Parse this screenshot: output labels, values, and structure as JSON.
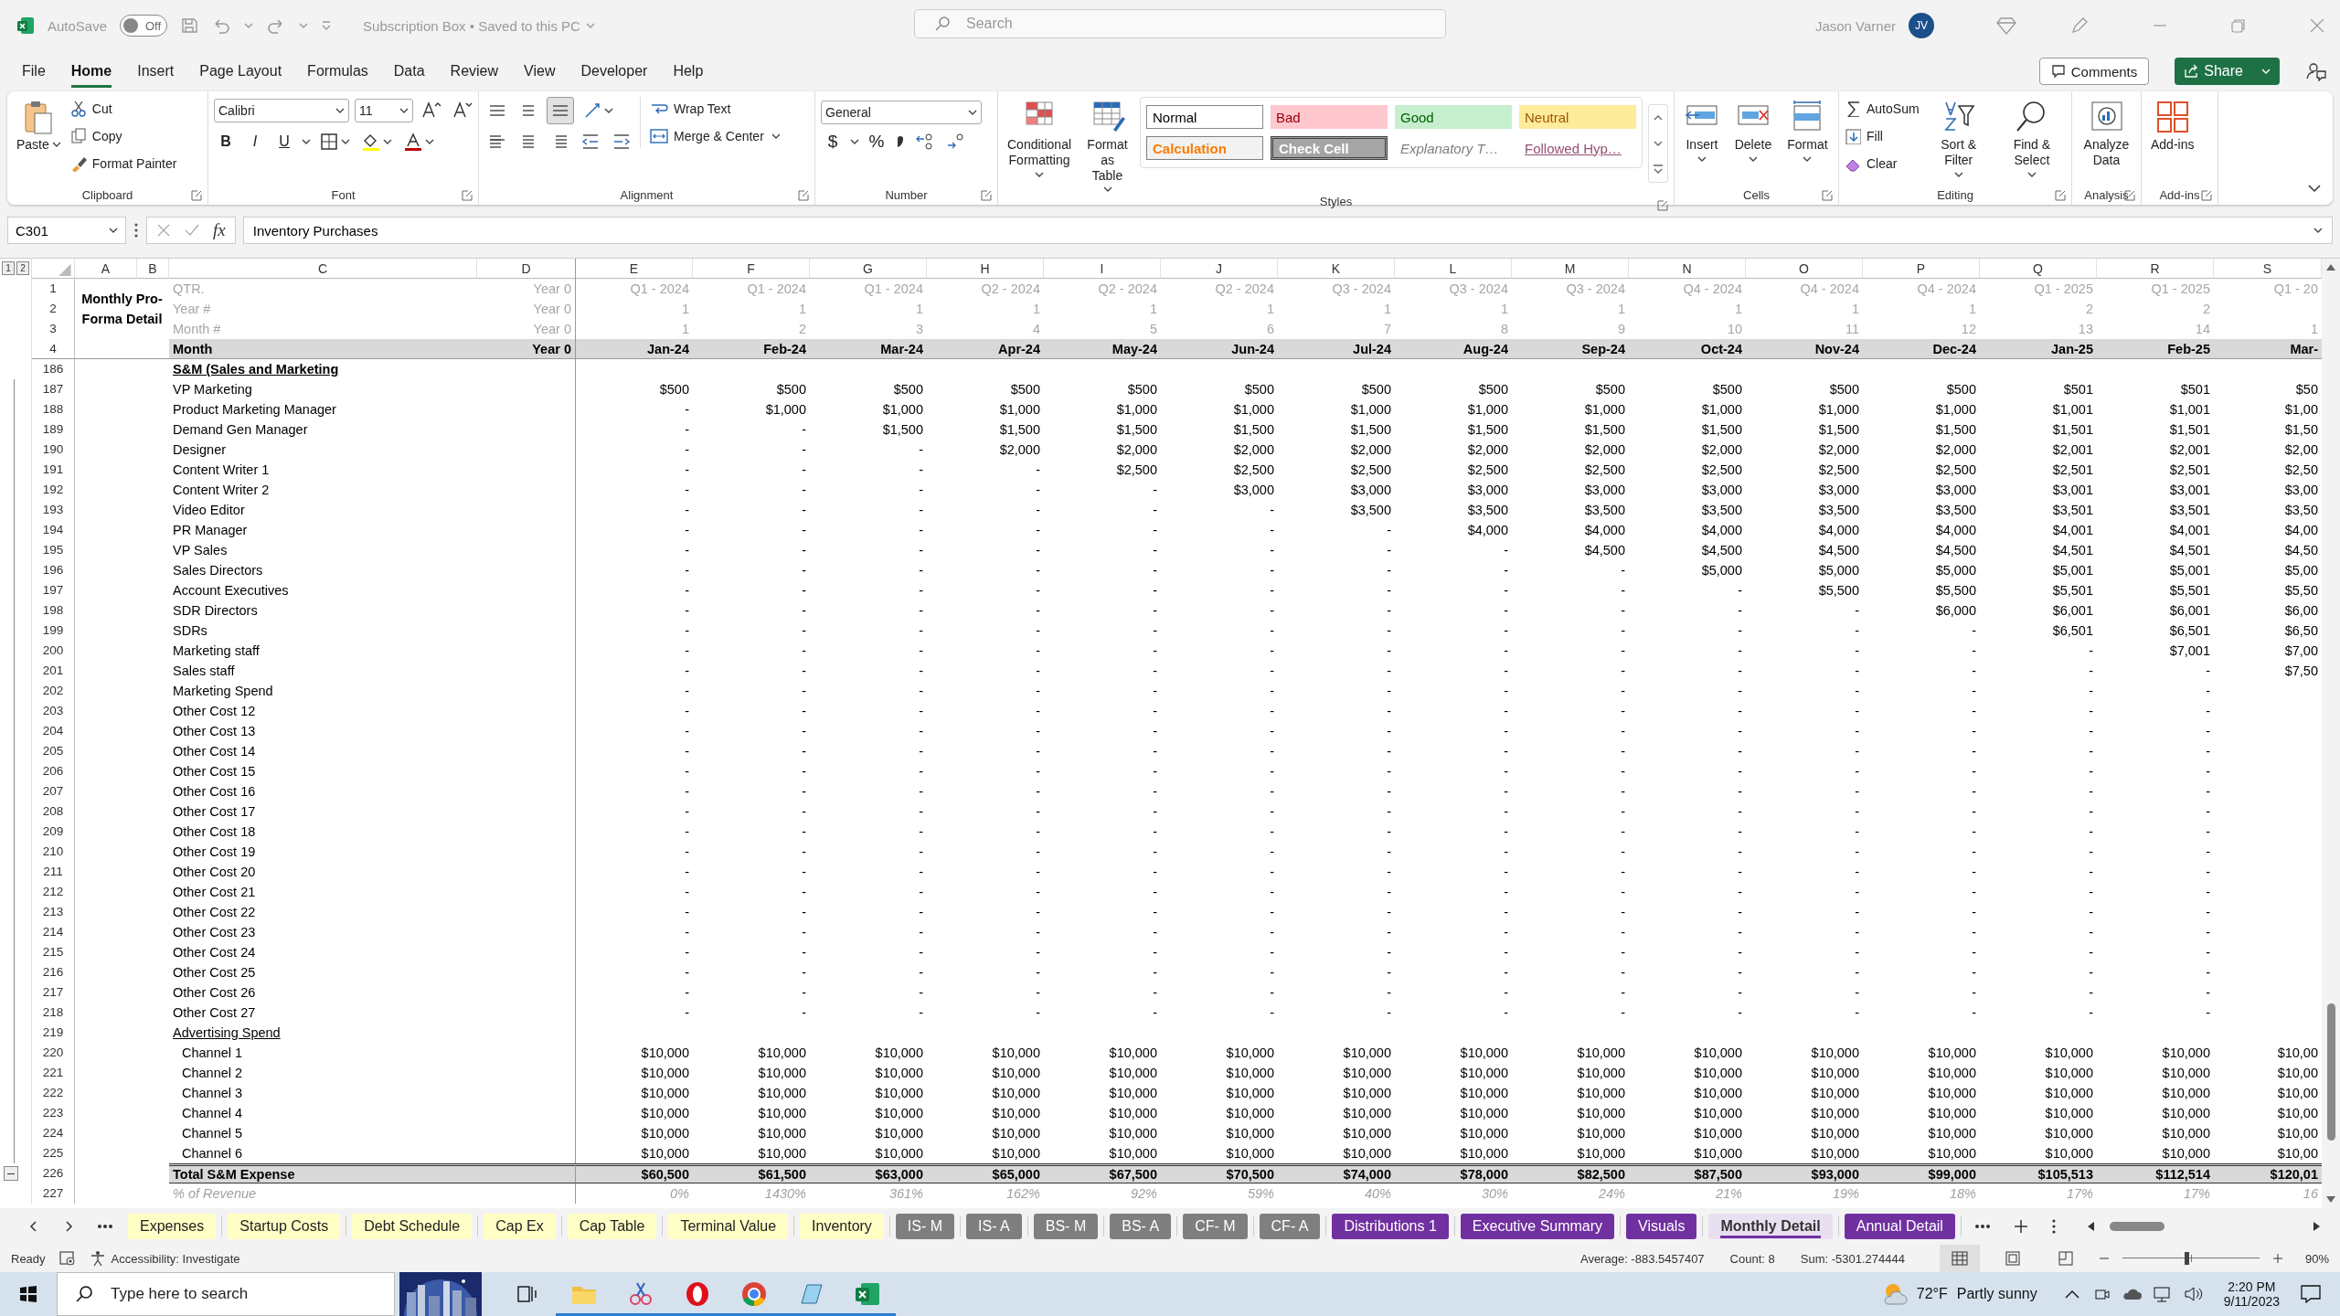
{
  "title_bar": {
    "autosave_label": "AutoSave",
    "autosave": {
      "label": "Off",
      "on": false
    },
    "document_title": "Subscription Box • Saved to this PC",
    "search_placeholder": "Search",
    "user_name": "Jason Varner",
    "user_initials": "JV"
  },
  "menu_tabs": [
    {
      "label": "File",
      "selected": false
    },
    {
      "label": "Home",
      "selected": true
    },
    {
      "label": "Insert",
      "selected": false
    },
    {
      "label": "Page Layout",
      "selected": false
    },
    {
      "label": "Formulas",
      "selected": false
    },
    {
      "label": "Data",
      "selected": false
    },
    {
      "label": "Review",
      "selected": false
    },
    {
      "label": "View",
      "selected": false
    },
    {
      "label": "Developer",
      "selected": false
    },
    {
      "label": "Help",
      "selected": false
    }
  ],
  "actions": {
    "comments": "Comments",
    "share": "Share"
  },
  "ribbon": {
    "clipboard": {
      "title": "Clipboard",
      "paste": "Paste",
      "cut": "Cut",
      "copy": "Copy",
      "format_painter": "Format Painter"
    },
    "font": {
      "title": "Font",
      "font_name": "Calibri",
      "font_size": "11",
      "style_buttons": [
        "B",
        "I",
        "U"
      ]
    },
    "alignment": {
      "title": "Alignment",
      "wrap_text": "Wrap Text",
      "merge_center": "Merge & Center"
    },
    "number": {
      "title": "Number",
      "format": "General",
      "symbols": [
        "$",
        "%"
      ]
    },
    "styles": {
      "title": "Styles",
      "conditional_formatting": "Conditional Formatting",
      "format_as_table": "Format as Table",
      "cell_styles": [
        {
          "label": "Normal",
          "kind": "normal"
        },
        {
          "label": "Bad",
          "kind": "bad"
        },
        {
          "label": "Good",
          "kind": "good"
        },
        {
          "label": "Neutral",
          "kind": "neutral"
        },
        {
          "label": "Calculation",
          "kind": "calculation"
        },
        {
          "label": "Check Cell",
          "kind": "check"
        },
        {
          "label": "Explanatory T…",
          "kind": "explanatory"
        },
        {
          "label": "Followed Hyp…",
          "kind": "hyperlink"
        }
      ]
    },
    "cells": {
      "title": "Cells",
      "buttons": [
        "Insert",
        "Delete",
        "Format"
      ]
    },
    "editing": {
      "title": "Editing",
      "autosum": "AutoSum",
      "fill": "Fill",
      "clear": "Clear",
      "sort_filter": "Sort & Filter",
      "find_select": "Find & Select"
    },
    "analysis": {
      "title": "Analysis",
      "analyze_data": "Analyze Data"
    },
    "add_ins": {
      "title": "Add-ins",
      "add_ins": "Add-ins"
    }
  },
  "formula_bar": {
    "name_box": "C301",
    "function_label": "fx",
    "formula": "Inventory Purchases"
  },
  "sheet": {
    "outline_levels": [
      "1",
      "2"
    ],
    "columns": [
      "A",
      "B",
      "C",
      "D",
      "E",
      "F",
      "G",
      "H",
      "I",
      "J",
      "K",
      "L",
      "M",
      "N",
      "O",
      "P",
      "Q",
      "R",
      "S"
    ],
    "title_cell": "Monthly Pro-Forma Detail",
    "header_rows": [
      {
        "number": "1",
        "kind": "info",
        "label": "QTR.",
        "year0": "Year 0",
        "values": [
          "Q1 - 2024",
          "Q1 - 2024",
          "Q1 - 2024",
          "Q2 - 2024",
          "Q2 - 2024",
          "Q2 - 2024",
          "Q3 - 2024",
          "Q3 - 2024",
          "Q3 - 2024",
          "Q4 - 2024",
          "Q4 - 2024",
          "Q4 - 2024",
          "Q1 - 2025",
          "Q1 - 2025",
          "Q1 - 20"
        ]
      },
      {
        "number": "2",
        "kind": "info",
        "label": "Year #",
        "year0": "Year 0",
        "values": [
          "1",
          "1",
          "1",
          "1",
          "1",
          "1",
          "1",
          "1",
          "1",
          "1",
          "1",
          "1",
          "2",
          "2"
        ]
      },
      {
        "number": "3",
        "kind": "info",
        "label": "Month #",
        "year0": "Year 0",
        "values": [
          "1",
          "2",
          "3",
          "4",
          "5",
          "6",
          "7",
          "8",
          "9",
          "10",
          "11",
          "12",
          "13",
          "14",
          "1"
        ]
      },
      {
        "number": "4",
        "kind": "month",
        "label": "Month",
        "year0": "Year 0",
        "values": [
          "Jan-24",
          "Feb-24",
          "Mar-24",
          "Apr-24",
          "May-24",
          "Jun-24",
          "Jul-24",
          "Aug-24",
          "Sep-24",
          "Oct-24",
          "Nov-24",
          "Dec-24",
          "Jan-25",
          "Feb-25",
          "Mar-"
        ]
      }
    ],
    "rows": [
      {
        "number": "186",
        "kind": "section",
        "label": "S&M (Sales and Marketing"
      },
      {
        "number": "187",
        "kind": "item",
        "label": "VP Marketing",
        "values": [
          "$500",
          "$500",
          "$500",
          "$500",
          "$500",
          "$500",
          "$500",
          "$500",
          "$500",
          "$500",
          "$500",
          "$500",
          "$501",
          "$501",
          "$50"
        ]
      },
      {
        "number": "188",
        "kind": "item",
        "label": "Product Marketing Manager",
        "values": [
          "-",
          "$1,000",
          "$1,000",
          "$1,000",
          "$1,000",
          "$1,000",
          "$1,000",
          "$1,000",
          "$1,000",
          "$1,000",
          "$1,000",
          "$1,000",
          "$1,001",
          "$1,001",
          "$1,00"
        ]
      },
      {
        "number": "189",
        "kind": "item",
        "label": "Demand Gen Manager",
        "values": [
          "-",
          "-",
          "$1,500",
          "$1,500",
          "$1,500",
          "$1,500",
          "$1,500",
          "$1,500",
          "$1,500",
          "$1,500",
          "$1,500",
          "$1,500",
          "$1,501",
          "$1,501",
          "$1,50"
        ]
      },
      {
        "number": "190",
        "kind": "item",
        "label": "Designer",
        "values": [
          "-",
          "-",
          "-",
          "$2,000",
          "$2,000",
          "$2,000",
          "$2,000",
          "$2,000",
          "$2,000",
          "$2,000",
          "$2,000",
          "$2,000",
          "$2,001",
          "$2,001",
          "$2,00"
        ]
      },
      {
        "number": "191",
        "kind": "item",
        "label": "Content Writer 1",
        "values": [
          "-",
          "-",
          "-",
          "-",
          "$2,500",
          "$2,500",
          "$2,500",
          "$2,500",
          "$2,500",
          "$2,500",
          "$2,500",
          "$2,500",
          "$2,501",
          "$2,501",
          "$2,50"
        ]
      },
      {
        "number": "192",
        "kind": "item",
        "label": "Content Writer 2",
        "values": [
          "-",
          "-",
          "-",
          "-",
          "-",
          "$3,000",
          "$3,000",
          "$3,000",
          "$3,000",
          "$3,000",
          "$3,000",
          "$3,000",
          "$3,001",
          "$3,001",
          "$3,00"
        ]
      },
      {
        "number": "193",
        "kind": "item",
        "label": "Video Editor",
        "values": [
          "-",
          "-",
          "-",
          "-",
          "-",
          "-",
          "$3,500",
          "$3,500",
          "$3,500",
          "$3,500",
          "$3,500",
          "$3,500",
          "$3,501",
          "$3,501",
          "$3,50"
        ]
      },
      {
        "number": "194",
        "kind": "item",
        "label": "PR Manager",
        "values": [
          "-",
          "-",
          "-",
          "-",
          "-",
          "-",
          "-",
          "$4,000",
          "$4,000",
          "$4,000",
          "$4,000",
          "$4,000",
          "$4,001",
          "$4,001",
          "$4,00"
        ]
      },
      {
        "number": "195",
        "kind": "item",
        "label": "VP Sales",
        "values": [
          "-",
          "-",
          "-",
          "-",
          "-",
          "-",
          "-",
          "-",
          "$4,500",
          "$4,500",
          "$4,500",
          "$4,500",
          "$4,501",
          "$4,501",
          "$4,50"
        ]
      },
      {
        "number": "196",
        "kind": "item",
        "label": "Sales Directors",
        "values": [
          "-",
          "-",
          "-",
          "-",
          "-",
          "-",
          "-",
          "-",
          "-",
          "$5,000",
          "$5,000",
          "$5,000",
          "$5,001",
          "$5,001",
          "$5,00"
        ]
      },
      {
        "number": "197",
        "kind": "item",
        "label": "Account Executives",
        "values": [
          "-",
          "-",
          "-",
          "-",
          "-",
          "-",
          "-",
          "-",
          "-",
          "-",
          "$5,500",
          "$5,500",
          "$5,501",
          "$5,501",
          "$5,50"
        ]
      },
      {
        "number": "198",
        "kind": "item",
        "label": "SDR Directors",
        "values": [
          "-",
          "-",
          "-",
          "-",
          "-",
          "-",
          "-",
          "-",
          "-",
          "-",
          "-",
          "$6,000",
          "$6,001",
          "$6,001",
          "$6,00"
        ]
      },
      {
        "number": "199",
        "kind": "item",
        "label": "SDRs",
        "values": [
          "-",
          "-",
          "-",
          "-",
          "-",
          "-",
          "-",
          "-",
          "-",
          "-",
          "-",
          "-",
          "$6,501",
          "$6,501",
          "$6,50"
        ]
      },
      {
        "number": "200",
        "kind": "item",
        "label": "Marketing staff",
        "values": [
          "-",
          "-",
          "-",
          "-",
          "-",
          "-",
          "-",
          "-",
          "-",
          "-",
          "-",
          "-",
          "-",
          "$7,001",
          "$7,00"
        ]
      },
      {
        "number": "201",
        "kind": "item",
        "label": "Sales staff",
        "values": [
          "-",
          "-",
          "-",
          "-",
          "-",
          "-",
          "-",
          "-",
          "-",
          "-",
          "-",
          "-",
          "-",
          "-",
          "$7,50"
        ]
      },
      {
        "number": "202",
        "kind": "item",
        "label": "Marketing Spend",
        "values": [
          "-",
          "-",
          "-",
          "-",
          "-",
          "-",
          "-",
          "-",
          "-",
          "-",
          "-",
          "-",
          "-",
          "-"
        ]
      },
      {
        "number": "203",
        "kind": "item",
        "label": "Other Cost 12",
        "values": [
          "-",
          "-",
          "-",
          "-",
          "-",
          "-",
          "-",
          "-",
          "-",
          "-",
          "-",
          "-",
          "-",
          "-"
        ]
      },
      {
        "number": "204",
        "kind": "item",
        "label": "Other Cost 13",
        "values": [
          "-",
          "-",
          "-",
          "-",
          "-",
          "-",
          "-",
          "-",
          "-",
          "-",
          "-",
          "-",
          "-",
          "-"
        ]
      },
      {
        "number": "205",
        "kind": "item",
        "label": "Other Cost 14",
        "values": [
          "-",
          "-",
          "-",
          "-",
          "-",
          "-",
          "-",
          "-",
          "-",
          "-",
          "-",
          "-",
          "-",
          "-"
        ]
      },
      {
        "number": "206",
        "kind": "item",
        "label": "Other Cost 15",
        "values": [
          "-",
          "-",
          "-",
          "-",
          "-",
          "-",
          "-",
          "-",
          "-",
          "-",
          "-",
          "-",
          "-",
          "-"
        ]
      },
      {
        "number": "207",
        "kind": "item",
        "label": "Other Cost 16",
        "values": [
          "-",
          "-",
          "-",
          "-",
          "-",
          "-",
          "-",
          "-",
          "-",
          "-",
          "-",
          "-",
          "-",
          "-"
        ]
      },
      {
        "number": "208",
        "kind": "item",
        "label": "Other Cost 17",
        "values": [
          "-",
          "-",
          "-",
          "-",
          "-",
          "-",
          "-",
          "-",
          "-",
          "-",
          "-",
          "-",
          "-",
          "-"
        ]
      },
      {
        "number": "209",
        "kind": "item",
        "label": "Other Cost 18",
        "values": [
          "-",
          "-",
          "-",
          "-",
          "-",
          "-",
          "-",
          "-",
          "-",
          "-",
          "-",
          "-",
          "-",
          "-"
        ]
      },
      {
        "number": "210",
        "kind": "item",
        "label": "Other Cost 19",
        "values": [
          "-",
          "-",
          "-",
          "-",
          "-",
          "-",
          "-",
          "-",
          "-",
          "-",
          "-",
          "-",
          "-",
          "-"
        ]
      },
      {
        "number": "211",
        "kind": "item",
        "label": "Other Cost 20",
        "values": [
          "-",
          "-",
          "-",
          "-",
          "-",
          "-",
          "-",
          "-",
          "-",
          "-",
          "-",
          "-",
          "-",
          "-"
        ]
      },
      {
        "number": "212",
        "kind": "item",
        "label": "Other Cost 21",
        "values": [
          "-",
          "-",
          "-",
          "-",
          "-",
          "-",
          "-",
          "-",
          "-",
          "-",
          "-",
          "-",
          "-",
          "-"
        ]
      },
      {
        "number": "213",
        "kind": "item",
        "label": "Other Cost 22",
        "values": [
          "-",
          "-",
          "-",
          "-",
          "-",
          "-",
          "-",
          "-",
          "-",
          "-",
          "-",
          "-",
          "-",
          "-"
        ]
      },
      {
        "number": "214",
        "kind": "item",
        "label": "Other Cost 23",
        "values": [
          "-",
          "-",
          "-",
          "-",
          "-",
          "-",
          "-",
          "-",
          "-",
          "-",
          "-",
          "-",
          "-",
          "-"
        ]
      },
      {
        "number": "215",
        "kind": "item",
        "label": "Other Cost 24",
        "values": [
          "-",
          "-",
          "-",
          "-",
          "-",
          "-",
          "-",
          "-",
          "-",
          "-",
          "-",
          "-",
          "-",
          "-"
        ]
      },
      {
        "number": "216",
        "kind": "item",
        "label": "Other Cost 25",
        "values": [
          "-",
          "-",
          "-",
          "-",
          "-",
          "-",
          "-",
          "-",
          "-",
          "-",
          "-",
          "-",
          "-",
          "-"
        ]
      },
      {
        "number": "217",
        "kind": "item",
        "label": "Other Cost 26",
        "values": [
          "-",
          "-",
          "-",
          "-",
          "-",
          "-",
          "-",
          "-",
          "-",
          "-",
          "-",
          "-",
          "-",
          "-"
        ]
      },
      {
        "number": "218",
        "kind": "item",
        "label": "Other Cost 27",
        "values": [
          "-",
          "-",
          "-",
          "-",
          "-",
          "-",
          "-",
          "-",
          "-",
          "-",
          "-",
          "-",
          "-",
          "-"
        ]
      },
      {
        "number": "219",
        "kind": "subheading",
        "label": "Advertising Spend"
      },
      {
        "number": "220",
        "kind": "subitem",
        "label": "Channel 1",
        "values": [
          "$10,000",
          "$10,000",
          "$10,000",
          "$10,000",
          "$10,000",
          "$10,000",
          "$10,000",
          "$10,000",
          "$10,000",
          "$10,000",
          "$10,000",
          "$10,000",
          "$10,000",
          "$10,000",
          "$10,00"
        ]
      },
      {
        "number": "221",
        "kind": "subitem",
        "label": "Channel 2",
        "values": [
          "$10,000",
          "$10,000",
          "$10,000",
          "$10,000",
          "$10,000",
          "$10,000",
          "$10,000",
          "$10,000",
          "$10,000",
          "$10,000",
          "$10,000",
          "$10,000",
          "$10,000",
          "$10,000",
          "$10,00"
        ]
      },
      {
        "number": "222",
        "kind": "subitem",
        "label": "Channel 3",
        "values": [
          "$10,000",
          "$10,000",
          "$10,000",
          "$10,000",
          "$10,000",
          "$10,000",
          "$10,000",
          "$10,000",
          "$10,000",
          "$10,000",
          "$10,000",
          "$10,000",
          "$10,000",
          "$10,000",
          "$10,00"
        ]
      },
      {
        "number": "223",
        "kind": "subitem",
        "label": "Channel 4",
        "values": [
          "$10,000",
          "$10,000",
          "$10,000",
          "$10,000",
          "$10,000",
          "$10,000",
          "$10,000",
          "$10,000",
          "$10,000",
          "$10,000",
          "$10,000",
          "$10,000",
          "$10,000",
          "$10,000",
          "$10,00"
        ]
      },
      {
        "number": "224",
        "kind": "subitem",
        "label": "Channel 5",
        "values": [
          "$10,000",
          "$10,000",
          "$10,000",
          "$10,000",
          "$10,000",
          "$10,000",
          "$10,000",
          "$10,000",
          "$10,000",
          "$10,000",
          "$10,000",
          "$10,000",
          "$10,000",
          "$10,000",
          "$10,00"
        ]
      },
      {
        "number": "225",
        "kind": "subitem",
        "label": "Channel 6",
        "values": [
          "$10,000",
          "$10,000",
          "$10,000",
          "$10,000",
          "$10,000",
          "$10,000",
          "$10,000",
          "$10,000",
          "$10,000",
          "$10,000",
          "$10,000",
          "$10,000",
          "$10,000",
          "$10,000",
          "$10,00"
        ]
      },
      {
        "number": "226",
        "kind": "total",
        "label": "Total S&M Expense",
        "values": [
          "$60,500",
          "$61,500",
          "$63,000",
          "$65,000",
          "$67,500",
          "$70,500",
          "$74,000",
          "$78,000",
          "$82,500",
          "$87,500",
          "$93,000",
          "$99,000",
          "$105,513",
          "$112,514",
          "$120,01"
        ]
      },
      {
        "number": "227",
        "kind": "percent",
        "label": "% of Revenue",
        "values": [
          "0%",
          "1430%",
          "361%",
          "162%",
          "92%",
          "59%",
          "40%",
          "30%",
          "24%",
          "21%",
          "19%",
          "18%",
          "17%",
          "17%",
          "16"
        ]
      }
    ]
  },
  "sheet_tabs": [
    {
      "label": "Expenses",
      "color": "#ffffc5",
      "selected": false
    },
    {
      "label": "Startup Costs",
      "color": "#ffffc5",
      "selected": false
    },
    {
      "label": "Debt Schedule",
      "color": "#ffffc5",
      "selected": false
    },
    {
      "label": "Cap Ex",
      "color": "#ffffc5",
      "selected": false
    },
    {
      "label": "Cap Table",
      "color": "#ffffc5",
      "selected": false
    },
    {
      "label": "Terminal Value",
      "color": "#ffffc5",
      "selected": false
    },
    {
      "label": "Inventory",
      "color": "#ffffc5",
      "selected": false
    },
    {
      "label": "IS- M",
      "color": "#7f7f7f",
      "selected": false
    },
    {
      "label": "IS- A",
      "color": "#7f7f7f",
      "selected": false
    },
    {
      "label": "BS- M",
      "color": "#7f7f7f",
      "selected": false
    },
    {
      "label": "BS- A",
      "color": "#7f7f7f",
      "selected": false
    },
    {
      "label": "CF- M",
      "color": "#7f7f7f",
      "selected": false
    },
    {
      "label": "CF- A",
      "color": "#7f7f7f",
      "selected": false
    },
    {
      "label": "Distributions 1",
      "color": "#7030a0",
      "selected": false
    },
    {
      "label": "Executive Summary",
      "color": "#7030a0",
      "selected": false
    },
    {
      "label": "Visuals",
      "color": "#7030a0",
      "selected": false
    },
    {
      "label": "Monthly Detail",
      "color": "#7030a0",
      "selected": true
    },
    {
      "label": "Annual Detail",
      "color": "#7030a0",
      "selected": false
    }
  ],
  "status_bar": {
    "ready": "Ready",
    "accessibility": "Accessibility: Investigate",
    "average": "Average: -883.5457407",
    "count": "Count: 8",
    "sum": "Sum: -5301.274444",
    "zoom_slider": {
      "level": 0.47
    },
    "zoom": "90%"
  },
  "taskbar": {
    "search_placeholder": "Type here to search",
    "pinned_apps": [
      {
        "running": true
      },
      {
        "running": true
      },
      {
        "running": true
      },
      {
        "running": true
      },
      {
        "running": true
      },
      {
        "running": true
      }
    ],
    "temperature": "72°F",
    "weather": "Partly sunny",
    "time": "2:20 PM",
    "date": "9/11/2023"
  }
}
